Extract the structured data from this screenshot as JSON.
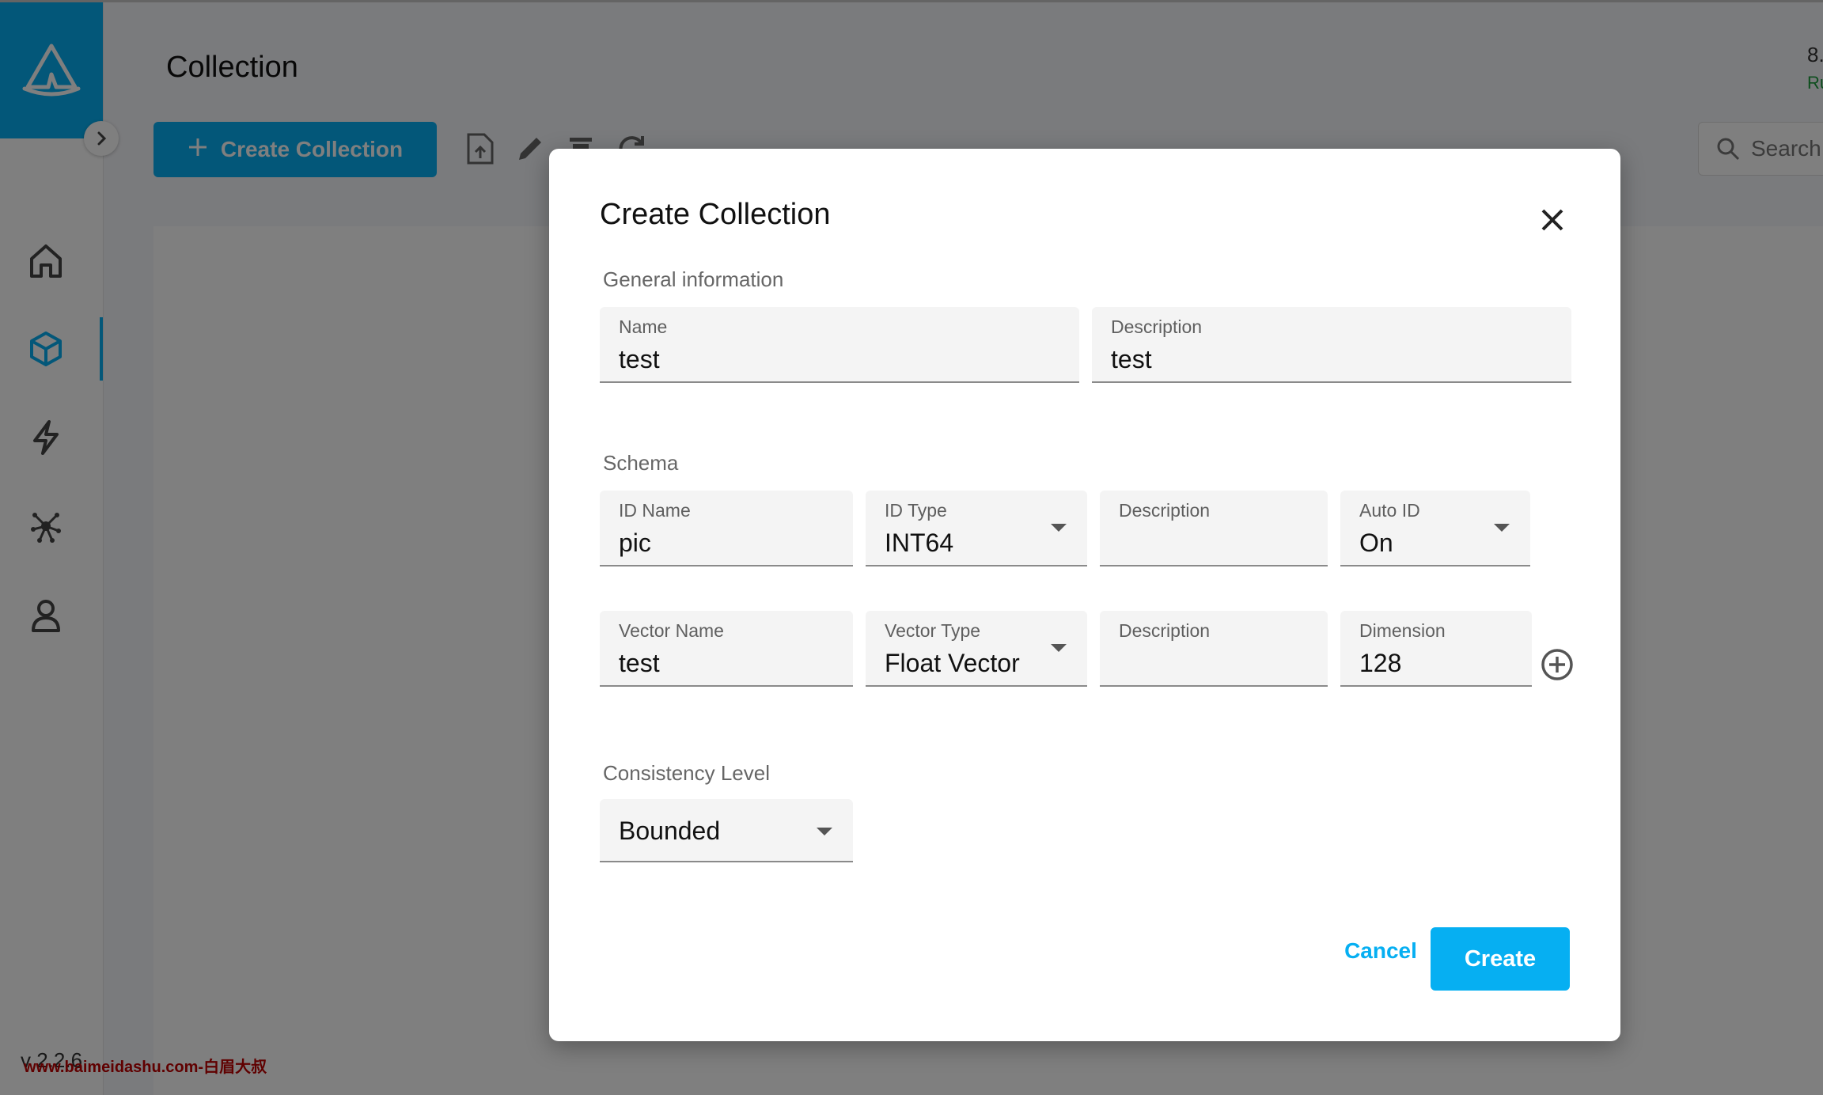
{
  "page": {
    "title": "Collection",
    "version": "v 2.2.6",
    "watermark": "www.baimeidashu.com-白眉大叔"
  },
  "toolbar": {
    "create_label": "Create Collection",
    "search_placeholder": "Search"
  },
  "top_right": {
    "number": "8.",
    "status": "Ru"
  },
  "sidebar": {
    "items": [
      "home-icon",
      "collection-cube-icon",
      "lightning-icon",
      "system-graph-icon",
      "user-icon"
    ],
    "active": "collection-cube-icon"
  },
  "colors": {
    "accent": "#06aff2",
    "overlay": "rgba(0,0,0,0.5)",
    "status_green": "#1a9c3c"
  },
  "dialog": {
    "title": "Create Collection",
    "general_label": "General information",
    "name": {
      "label": "Name",
      "value": "test"
    },
    "description": {
      "label": "Description",
      "value": "test"
    },
    "schema_label": "Schema",
    "id_name": {
      "label": "ID Name",
      "value": "pic"
    },
    "id_type": {
      "label": "ID Type",
      "value": "INT64"
    },
    "id_description": {
      "label": "Description",
      "value": ""
    },
    "auto_id": {
      "label": "Auto ID",
      "value": "On"
    },
    "vector_name": {
      "label": "Vector Name",
      "value": "test"
    },
    "vector_type": {
      "label": "Vector Type",
      "value": "Float Vector"
    },
    "vector_description": {
      "label": "Description",
      "value": ""
    },
    "dimension": {
      "label": "Dimension",
      "value": "128"
    },
    "consistency_label": "Consistency Level",
    "consistency": {
      "value": "Bounded"
    },
    "cancel_label": "Cancel",
    "create_label": "Create"
  }
}
